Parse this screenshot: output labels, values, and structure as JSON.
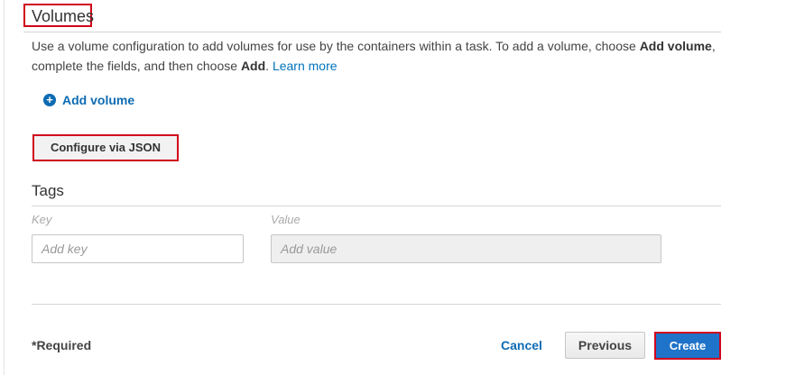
{
  "volumes": {
    "title": "Volumes",
    "description_prefix": "Use a volume configuration to add volumes for use by the containers within a task. To add a volume, choose ",
    "description_bold1": "Add volume",
    "description_mid": ", complete the fields, and then choose ",
    "description_bold2": "Add",
    "description_suffix": ". ",
    "learn_more": "Learn more",
    "add_volume_label": "Add volume",
    "add_volume_icon": "plus-circle-icon",
    "configure_json_label": "Configure via JSON"
  },
  "tags": {
    "title": "Tags",
    "key_header": "Key",
    "value_header": "Value",
    "key_placeholder": "Add key",
    "value_placeholder": "Add value"
  },
  "footer": {
    "required_label": "*Required",
    "cancel_label": "Cancel",
    "previous_label": "Previous",
    "create_label": "Create"
  },
  "colors": {
    "accent_link": "#0d6bb3",
    "primary_button": "#1f73c9",
    "highlight_border": "#d0021b"
  }
}
